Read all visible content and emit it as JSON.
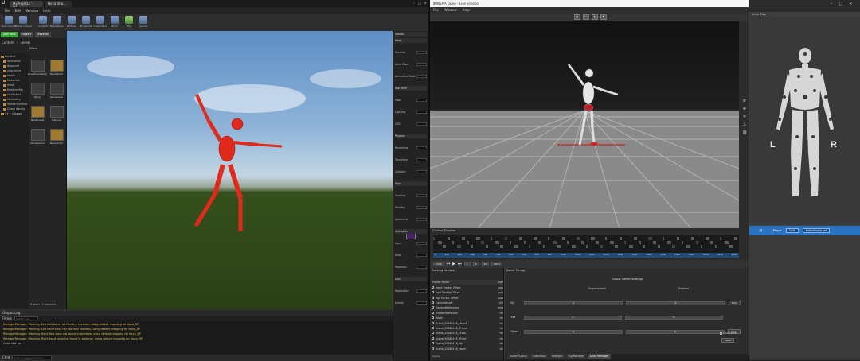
{
  "ue": {
    "tabs": [
      "MyProject2 - Un...",
      "Nova Sha..."
    ],
    "menu": [
      "File",
      "Edit",
      "Window",
      "Help"
    ],
    "toolbar": [
      "Save Current",
      "Source Control",
      "Content",
      "Marketplace",
      "Settings",
      "Blueprints",
      "Cinematics",
      "Build",
      "Play",
      "Launch"
    ],
    "cb": {
      "add_new": "Add New",
      "import": "Import",
      "save": "Save All",
      "path": [
        "Content",
        "Levels"
      ],
      "filters": "Filters",
      "tree": [
        "Content",
        "animation",
        "blueprint",
        "characters",
        "levels",
        "Materials",
        "mesh",
        "RealtimeMo",
        "Ue4Actors",
        "Geometry",
        "StarterContent",
        "Game Assets",
        "C++ Classes"
      ],
      "assets": [
        "NovaFoundation",
        "NovaWorld",
        "Nova",
        "NovaLevel",
        "Nova Level",
        "Capture",
        "MocapAnim",
        "Nova Actor"
      ],
      "count": "9 items (1 selected)"
    },
    "details": {
      "title": "Details",
      "rows": [
        "Mesh",
        "Skeletal",
        "Anim Class",
        "Animation Mode",
        "Use Anim",
        "Pose",
        "Lighting",
        "LOD",
        "Physics",
        "Rendering",
        "Transform",
        "Collision",
        "Tags",
        "Cooking",
        "Mobility",
        "Advanced",
        "Activation",
        "Input",
        "Actor",
        "Materials",
        "LOD",
        "Replication",
        "Events"
      ]
    },
    "output": {
      "tab": "Output Log",
      "filter": "Filters",
      "search": "Search Log",
      "lines": [
        "RetargetManager: Warning: Left foot bone not found in skeleton, using default mapping for Nova_BP",
        "RetargetManager: Warning: Left hand bone not found in skeleton, using default mapping for Nova_BP",
        "RetargetManager: Warning: Right foot bone not found in skeleton, using default mapping for Nova_BP",
        "RetargetManager: Warning: Right hand bone not found in skeleton, using default mapping for Nova_BP",
        "Cmd: stat fps"
      ],
      "cmd": "Cmd",
      "console": "Enter Console Command"
    }
  },
  "ik": {
    "title": "IKINEMA Orion - Live session",
    "menu": [
      "File",
      "Window",
      "Help"
    ],
    "view_btn": "View",
    "timeline_label": "Capture Timeline",
    "ruler": [
      "0",
      "100",
      "200",
      "300",
      "400",
      "500",
      "600",
      "700",
      "800",
      "900",
      "1000",
      "1100",
      "1200",
      "1300",
      "1400",
      "1500",
      "1600",
      "1700",
      "1800",
      "1900",
      "2000",
      "2100",
      "2200"
    ],
    "playbar": [
      "1920",
      "0",
      "0",
      "30",
      "1051"
    ],
    "tracking": {
      "title": "Tracking Devices",
      "col_name": "Tracker Name",
      "col_type": "Type",
      "rows": [
        [
          "Hand Tracker Offset",
          "pos"
        ],
        [
          "Foot Tracker Offset",
          "pos"
        ],
        [
          "Hip Tracker Offset",
          "pos"
        ],
        [
          "ControllerLeft",
          "ctrl"
        ],
        [
          "HeadsetReference",
          "hmd"
        ],
        [
          "TrackerReference",
          "trk"
        ],
        [
          "Waist",
          "trk"
        ],
        [
          "Scene_20180418_LHand",
          "trk"
        ],
        [
          "Scene_20180418_RHand",
          "trk"
        ],
        [
          "Scene_20180418_LFoot",
          "trk"
        ],
        [
          "Scene_20180418_RFoot",
          "trk"
        ],
        [
          "Scene_20180418_Hip",
          "trk"
        ],
        [
          "Scene_20180418_Head",
          "trk"
        ]
      ]
    },
    "solver": {
      "title": "Solver Tuning",
      "heading": "Global Solver Settings",
      "col_a": "Displacement",
      "col_b": "Rotation",
      "rows": [
        [
          "Hip",
          "0",
          "0"
        ],
        [
          "Feet",
          "0",
          "0"
        ],
        [
          "Others",
          "0",
          "0"
        ]
      ],
      "btn_filter": "Filter",
      "btn_apply": "Apply",
      "lock_label": "Lock solver",
      "reset": "Reset",
      "tabs": [
        "Solver Tuning",
        "Calibration",
        "Retarget",
        "Rig Manager",
        "Actor Manager"
      ],
      "active_tab": 4
    },
    "status": "Ready"
  },
  "am": {
    "title": "Actor Map",
    "left": "L",
    "right": "R",
    "bar_label": "Player",
    "bar_btn": "Calib",
    "bar_select": "Default body set"
  }
}
